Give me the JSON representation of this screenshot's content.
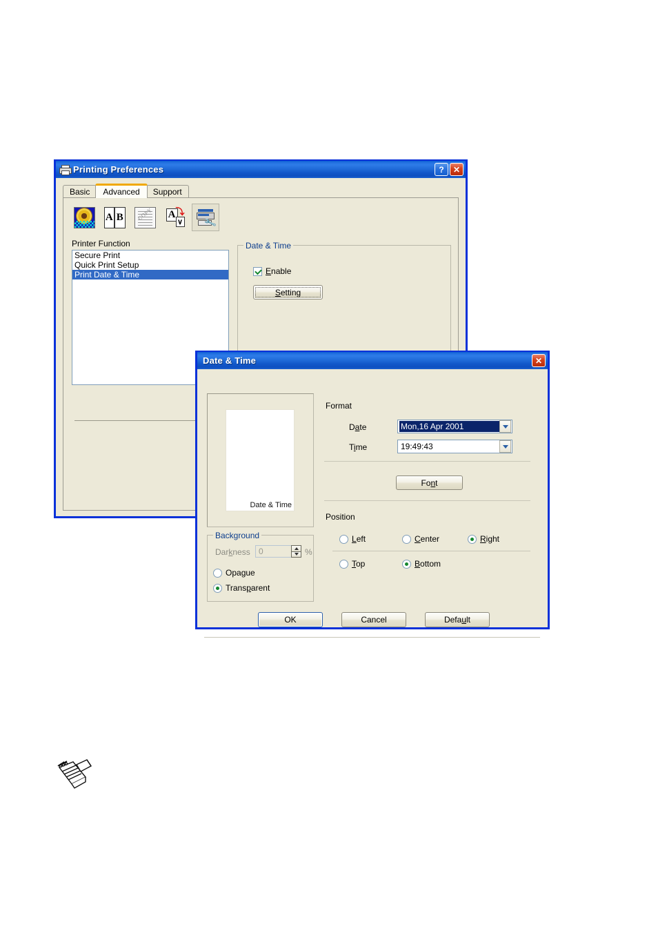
{
  "printing_preferences": {
    "title": "Printing Preferences",
    "title_icon": "printer-icon",
    "help_button": "?",
    "close_button": "✕",
    "tabs": [
      {
        "label": "Basic",
        "active": false
      },
      {
        "label": "Advanced",
        "active": true
      },
      {
        "label": "Support",
        "active": false
      }
    ],
    "toolbar_icons": [
      {
        "name": "print-quality-icon",
        "tooltip": "Print Quality"
      },
      {
        "name": "duplex-icon",
        "tooltip": "Duplex"
      },
      {
        "name": "watermark-icon",
        "tooltip": "Watermark"
      },
      {
        "name": "page-setting-icon",
        "tooltip": "Page Setting"
      },
      {
        "name": "device-options-icon",
        "tooltip": "Device Options",
        "selected": true
      }
    ],
    "printer_function": {
      "label": "Printer Function",
      "items": [
        {
          "label": "Secure Print",
          "selected": false
        },
        {
          "label": "Quick Print Setup",
          "selected": false
        },
        {
          "label": "Print Date & Time",
          "selected": true
        }
      ]
    },
    "date_time_group": {
      "label": "Date & Time",
      "enable_label": "Enable",
      "enable_checked": true,
      "setting_button": "Setting"
    }
  },
  "date_time_dialog": {
    "title": "Date & Time",
    "close_button": "✕",
    "preview": {
      "caption": "Date & Time"
    },
    "format": {
      "label": "Format",
      "date_label": "Date",
      "date_value": "Mon,16 Apr 2001",
      "date_selected": true,
      "time_label": "Time",
      "time_value": "19:49:43"
    },
    "font_button": "Font",
    "position": {
      "label": "Position",
      "horizontal": [
        {
          "label": "Left",
          "selected": false
        },
        {
          "label": "Center",
          "selected": false
        },
        {
          "label": "Right",
          "selected": true
        }
      ],
      "vertical": [
        {
          "label": "Top",
          "selected": false
        },
        {
          "label": "Bottom",
          "selected": true
        }
      ]
    },
    "background": {
      "label": "Background",
      "darkness_label": "Darkness",
      "darkness_value": "0",
      "percent_symbol": "%",
      "darkness_disabled": true,
      "modes": [
        {
          "label": "Opaque",
          "selected": false
        },
        {
          "label": "Transparent",
          "selected": true
        }
      ]
    },
    "buttons": [
      {
        "label": "OK",
        "default": true
      },
      {
        "label": "Cancel",
        "default": false
      },
      {
        "label": "Default",
        "default": false
      }
    ]
  },
  "page": {
    "note_icon": "note-pencil-icon"
  },
  "colors": {
    "titlebar_blue": "#0831d9",
    "dialog_face": "#ece9d8",
    "selection_blue": "#316ac5",
    "group_label_blue": "#0b3c8c",
    "active_tab_orange": "#f0a800",
    "close_red": "#d6431d",
    "radio_green": "#14872e"
  }
}
